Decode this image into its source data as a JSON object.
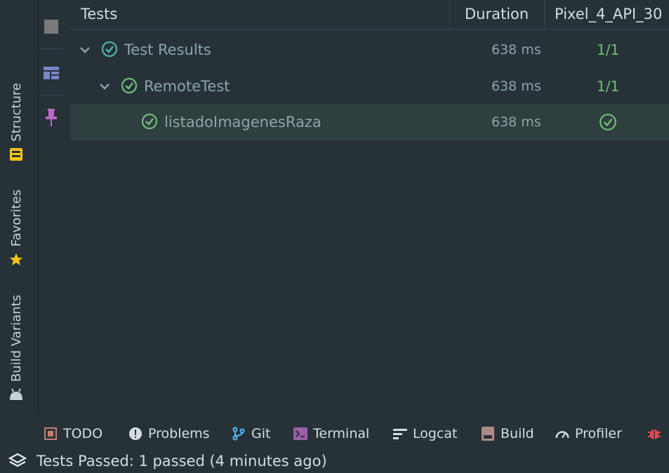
{
  "left_strip": {
    "structure_label": "Structure",
    "favorites_label": "Favorites",
    "build_variants_label": "Build Variants"
  },
  "tree": {
    "header": {
      "tests": "Tests",
      "duration": "Duration",
      "device": "Pixel_4_API_30"
    },
    "rows": [
      {
        "name": "Test Results",
        "duration": "638 ms",
        "count": "1/1",
        "status": "passed"
      },
      {
        "name": "RemoteTest",
        "duration": "638 ms",
        "count": "1/1",
        "status": "passed"
      },
      {
        "name": "listadoImagenesRaza",
        "duration": "638 ms",
        "count": "",
        "status": "passed"
      }
    ]
  },
  "bottom_bar": {
    "todo": "TODO",
    "problems": "Problems",
    "git": "Git",
    "terminal": "Terminal",
    "logcat": "Logcat",
    "build": "Build",
    "profiler": "Profiler"
  },
  "status_bar": {
    "message": "Tests Passed: 1 passed (4 minutes ago)"
  },
  "colors": {
    "background": "#263238",
    "pass_green": "#6fbf73",
    "pass_teal": "#4db6ac",
    "selected_row": "#2f3e3f"
  }
}
